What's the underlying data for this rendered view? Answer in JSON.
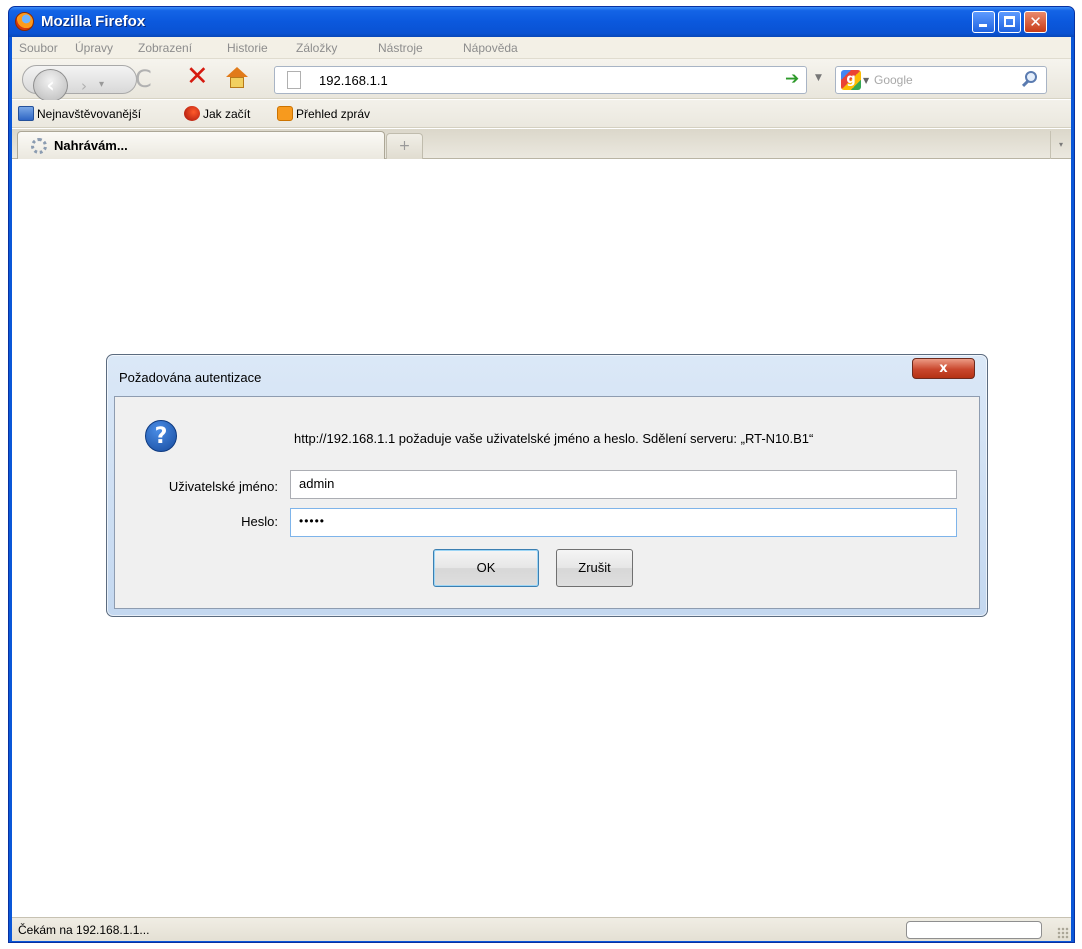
{
  "window": {
    "title": "Mozilla Firefox",
    "controls": {
      "minimize": "minimize",
      "maximize": "maximize",
      "close": "close"
    }
  },
  "menu": {
    "items": [
      "Soubor",
      "Úpravy",
      "Zobrazení",
      "Historie",
      "Záložky",
      "Nástroje",
      "Nápověda"
    ]
  },
  "navbar": {
    "url": "192.168.1.1",
    "search_placeholder": "Google",
    "back_glyph": "‹",
    "forward_glyph": "›",
    "reload_glyph": "C",
    "stop_glyph": "✕"
  },
  "bookmarks": {
    "items": [
      {
        "label": "Nejnavštěvovanější",
        "icon": "smart-bookmarks-icon"
      },
      {
        "label": "Jak začít",
        "icon": "firefox-icon"
      },
      {
        "label": "Přehled zpráv",
        "icon": "rss-icon"
      }
    ]
  },
  "tabs": {
    "active_label": "Nahrávám...",
    "new_tab_glyph": "+",
    "list_glyph": "▾"
  },
  "status": {
    "text": "Čekám na 192.168.1.1..."
  },
  "dialog": {
    "title": "Požadována autentizace",
    "close_glyph": "x",
    "message": "http://192.168.1.1 požaduje vaše uživatelské jméno a heslo. Sdělení serveru: „RT-N10.B1“",
    "username_label": "Uživatelské jméno:",
    "username_value": "admin",
    "password_label": "Heslo:",
    "password_value": "•••••",
    "ok_label": "OK",
    "cancel_label": "Zrušit",
    "icon": "question-icon"
  },
  "colors": {
    "titlebar": "#0a57d8",
    "stop": "#d61a0f",
    "go_arrow": "#2d9a2a",
    "dialog_close": "#c9472d"
  }
}
